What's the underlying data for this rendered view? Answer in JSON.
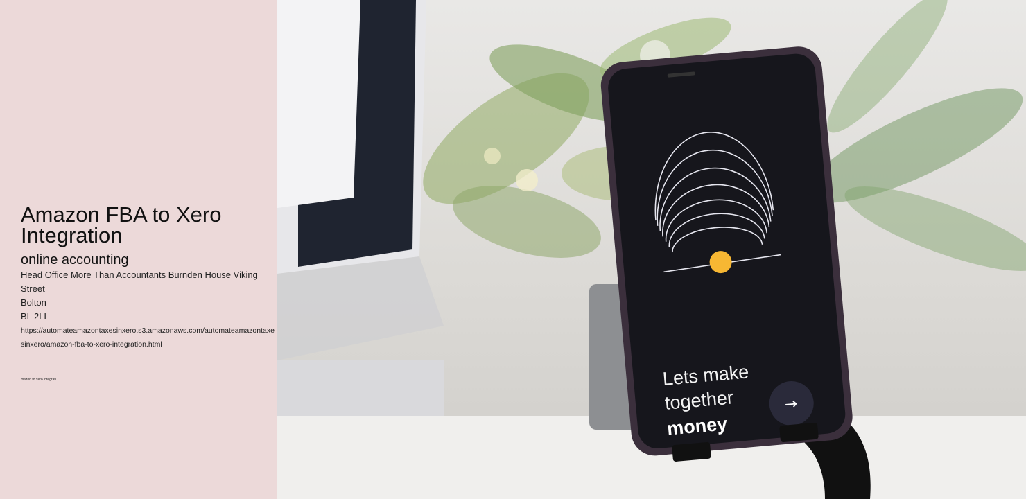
{
  "page": {
    "title": "Amazon FBA to Xero Integration",
    "subtitle": "online accounting",
    "address": {
      "line1": "Head Office More Than Accountants Burnden House Viking Street",
      "city": "Bolton",
      "postcode": "BL 2LL"
    },
    "url": "https://automateamazontaxesinxero.s3.amazonaws.com/automateamazontaxesinxero/amazon-fba-to-xero-integration.html",
    "tiny_label": "mazon to xero integrati"
  },
  "photo": {
    "phone_screen": {
      "line1": "Lets make",
      "line2": "together",
      "line3": "money",
      "arrow": "→"
    },
    "colors": {
      "panel": "#ecd9d9",
      "screen": "#16161c",
      "dot": "#f7b733"
    }
  }
}
